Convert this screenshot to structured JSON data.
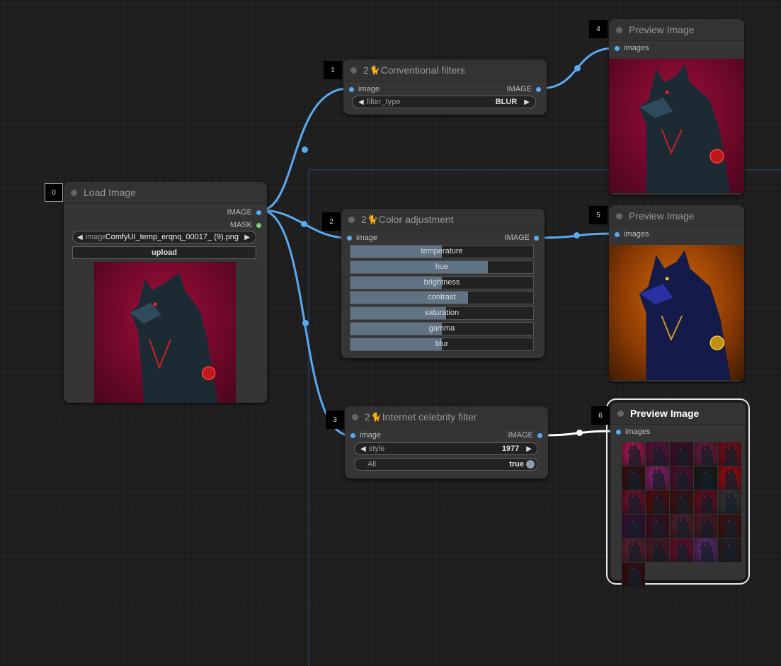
{
  "colors": {
    "link_image": "#5aaaf0",
    "link_selected": "#ffffff",
    "mask_slot": "#7fc87f",
    "slider_fill": "#5f7385",
    "node_bg": "#353535",
    "canvas_bg": "#202020"
  },
  "nodes": {
    "load_image": {
      "id": "0",
      "title": "Load Image",
      "outputs": [
        "IMAGE",
        "MASK"
      ],
      "image_widget": {
        "label": "image",
        "value": "ComfyUI_temp_erqnq_00017_ (9).png"
      },
      "upload_label": "upload",
      "preview_icon": "wolf-portrait-red-icon"
    },
    "conventional_filters": {
      "id": "1",
      "title_prefix": "2",
      "title_icon": "cat-emoji-icon",
      "title": "Conventional filters",
      "input": "image",
      "output": "IMAGE",
      "filter_type": {
        "label": "filter_type",
        "value": "BLUR"
      }
    },
    "color_adjustment": {
      "id": "2",
      "title_prefix": "2",
      "title_icon": "cat-emoji-icon",
      "title": "Color adjustment",
      "input": "image",
      "output": "IMAGE",
      "sliders": [
        {
          "label": "temperature",
          "fraction": 0.5
        },
        {
          "label": "hue",
          "fraction": 0.75
        },
        {
          "label": "brightness",
          "fraction": 0.5
        },
        {
          "label": "contrast",
          "fraction": 0.645
        },
        {
          "label": "saturation",
          "fraction": 0.525
        },
        {
          "label": "gamma",
          "fraction": 0.5
        },
        {
          "label": "blur",
          "fraction": 0.5
        }
      ]
    },
    "internet_celebrity_filter": {
      "id": "3",
      "title_prefix": "2",
      "title_icon": "cat-emoji-icon",
      "title": "Internet celebrity filter",
      "input": "image",
      "output": "IMAGE",
      "style": {
        "label": "style",
        "value": "1977"
      },
      "all_toggle": {
        "label": "All",
        "value": "true"
      }
    },
    "preview_4": {
      "id": "4",
      "title": "Preview Image",
      "input": "images"
    },
    "preview_5": {
      "id": "5",
      "title": "Preview Image",
      "input": "images"
    },
    "preview_6": {
      "id": "6",
      "title": "Preview Image",
      "input": "images",
      "selected": true,
      "thumbnail_count": 26
    }
  },
  "thumbnails": [
    "#c0185a",
    "#6a1040",
    "#4a0a2a",
    "#7a1a40",
    "#8a0a1a",
    "#3a1010",
    "#a0207a",
    "#5a1030",
    "#1a1a1a",
    "#b00a10",
    "#7a1030",
    "#600808",
    "#4a1010",
    "#7a0a20",
    "#3a3a3a",
    "#3a1040",
    "#4a0a20",
    "#5a2030",
    "#5a1828",
    "#4a1010",
    "#6a2030",
    "#5a1828",
    "#7a0a30",
    "#6a2a80",
    "#2a2020",
    "#3a0a10"
  ]
}
